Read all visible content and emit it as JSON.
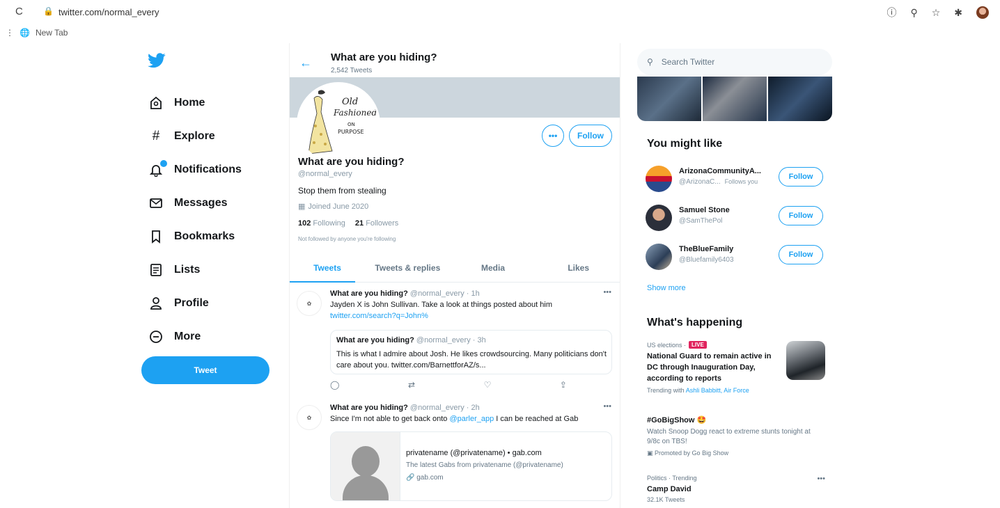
{
  "browser": {
    "url": "twitter.com/normal_every",
    "bookmark_tab": "New Tab"
  },
  "sidebar": {
    "items": [
      {
        "label": "Home",
        "icon": "home-icon"
      },
      {
        "label": "Explore",
        "icon": "hashtag-icon"
      },
      {
        "label": "Notifications",
        "icon": "bell-icon"
      },
      {
        "label": "Messages",
        "icon": "envelope-icon"
      },
      {
        "label": "Bookmarks",
        "icon": "bookmark-icon"
      },
      {
        "label": "Lists",
        "icon": "list-icon"
      },
      {
        "label": "Profile",
        "icon": "person-icon"
      },
      {
        "label": "More",
        "icon": "more-circle-icon"
      }
    ],
    "tweet_button": "Tweet"
  },
  "header": {
    "title": "What are you hiding?",
    "tweet_count": "2,542 Tweets"
  },
  "profile": {
    "logo_line1": "Old",
    "logo_line2": "Fashioned",
    "logo_line3": "ON",
    "logo_line4": "PURPOSE",
    "more_label": "•••",
    "follow_label": "Follow",
    "name": "What are you hiding?",
    "handle": "@normal_every",
    "bio": "Stop them from stealing",
    "joined": "Joined June 2020",
    "following_count": "102",
    "following_label": "Following",
    "followers_count": "21",
    "followers_label": "Followers",
    "not_followed": "Not followed by anyone you're following"
  },
  "tabs": [
    "Tweets",
    "Tweets & replies",
    "Media",
    "Likes"
  ],
  "tweets": [
    {
      "name": "What are you hiding?",
      "meta": "@normal_every · 1h",
      "text": "Jayden X is John Sullivan.  Take a look at things posted about him",
      "link": "twitter.com/search?q=John%",
      "quote": {
        "name": "What are you hiding?",
        "meta": "@normal_every · 3h",
        "text": "This is what I admire about Josh.  He likes crowdsourcing.  Many politicians don't care about you. twitter.com/BarnettforAZ/s..."
      }
    },
    {
      "name": "What are you hiding?",
      "meta": "@normal_every · 2h",
      "text_before": "Since I'm not able to get back onto ",
      "mention": "@parler_app",
      "text_after": " I can be reached at Gab",
      "card": {
        "title": "privatename (@privatename) • gab.com",
        "desc": "The latest Gabs from privatename (@privatename)",
        "link": "gab.com"
      }
    }
  ],
  "right": {
    "search_placeholder": "Search Twitter",
    "you_might_like": "You might like",
    "suggestions": [
      {
        "name": "ArizonaCommunityA...",
        "handle": "@ArizonaC...",
        "follows_you": "Follows you",
        "button": "Follow"
      },
      {
        "name": "Samuel Stone",
        "handle": "@SamThePol",
        "follows_you": "",
        "button": "Follow"
      },
      {
        "name": "TheBlueFamily",
        "handle": "@Bluefamily6403",
        "follows_you": "",
        "button": "Follow"
      }
    ],
    "show_more": "Show more",
    "whats_happening": "What's happening",
    "trends": [
      {
        "meta": "US elections ·",
        "live": "LIVE",
        "headline": "National Guard to remain active in DC through Inauguration Day, according to reports",
        "sub_prefix": "Trending with",
        "sub_links": "Ashli Babbitt, Air Force"
      },
      {
        "headline": "#GoBigShow 🤩",
        "body": "Watch Snoop Dogg react to extreme stunts tonight at 9/8c on TBS!",
        "promoted": "Promoted by Go Big Show"
      },
      {
        "meta": "Politics · Trending",
        "headline": "Camp David",
        "count": "32.1K Tweets"
      }
    ]
  },
  "colors": {
    "accent": "#1da1f2",
    "live": "#e0245e",
    "text": "#14171a",
    "muted": "#657786"
  }
}
